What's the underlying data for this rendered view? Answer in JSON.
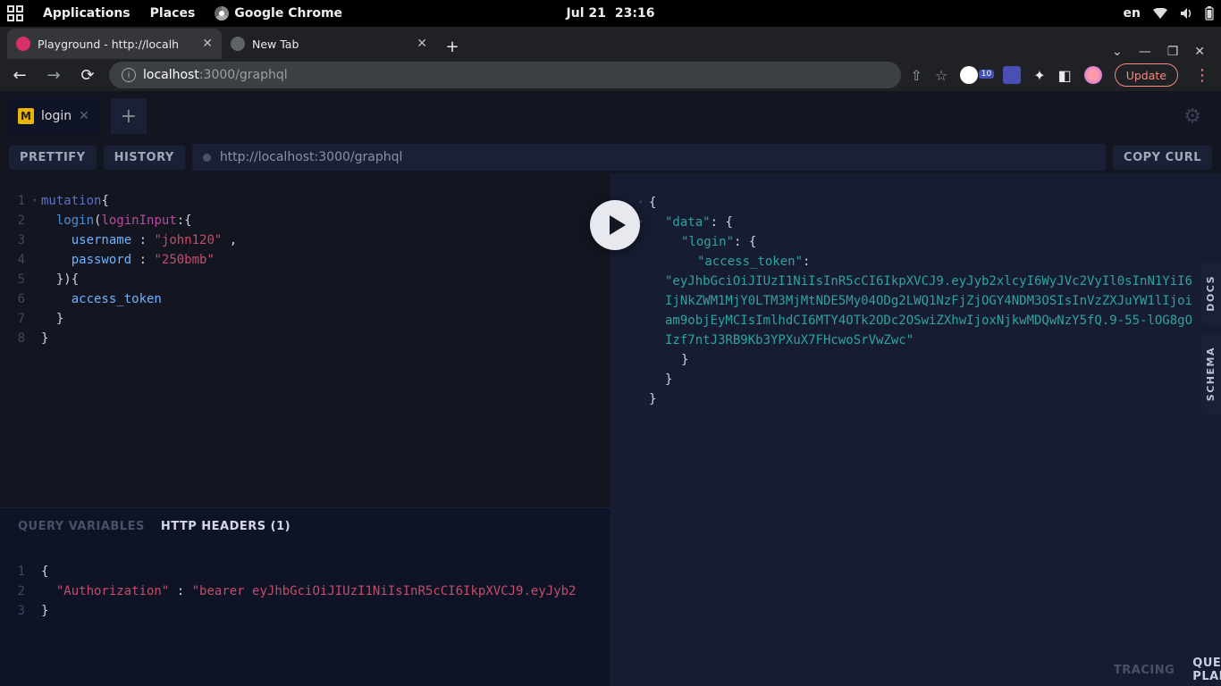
{
  "gnome": {
    "applications": "Applications",
    "places": "Places",
    "chrome": "Google Chrome",
    "date": "Jul 21",
    "time": "23:16",
    "lang": "en"
  },
  "chrome": {
    "tabs": [
      {
        "title": "Playground - http://localh"
      },
      {
        "title": "New Tab"
      }
    ],
    "url_host": "localhost",
    "url_rest": ":3000/graphql",
    "update": "Update",
    "ext_badge": "10"
  },
  "playground": {
    "tab": {
      "badge": "M",
      "name": "login"
    },
    "prettify": "PRETTIFY",
    "history": "HISTORY",
    "copy_curl": "COPY CURL",
    "endpoint": "http://localhost:3000/graphql",
    "side": {
      "docs": "DOCS",
      "schema": "SCHEMA"
    },
    "query": {
      "lines": [
        "1",
        "2",
        "3",
        "4",
        "5",
        "6",
        "7",
        "8"
      ],
      "kw_mutation": "mutation",
      "field_login": "login",
      "arg_loginInput": "loginInput",
      "attr_username": "username",
      "val_username": "\"john120\"",
      "attr_password": "password",
      "val_password": "\"250bmb\"",
      "attr_access_token": "access_token"
    },
    "response": {
      "data_key": "\"data\"",
      "login_key": "\"login\"",
      "access_token_key": "\"access_token\"",
      "token": "\"eyJhbGciOiJIUzI1NiIsInR5cCI6IkpXVCJ9.eyJyb2xlcyI6WyJVc2VyIl0sInN1YiI6IjNkZWM1MjY0LTM3MjMtNDE5My04ODg2LWQ1NzFjZjOGY4NDM3OSIsInVzZXJuYW1lIjoiam9objEyMCIsImlhdCI6MTY4OTk2ODc2OSwiZXhwIjoxNjkwMDQwNzY5fQ.9-55-lOG8gOIzf7ntJ3RB9Kb3YPXuX7FHcwoSrVwZwc\""
    },
    "vars": {
      "query_variables": "QUERY VARIABLES",
      "http_headers": "HTTP HEADERS (1)",
      "lines": [
        "1",
        "2",
        "3"
      ],
      "auth_key": "\"Authorization\"",
      "auth_val": "\"bearer eyJhbGciOiJIUzI1NiIsInR5cCI6IkpXVCJ9.eyJyb2"
    },
    "footer": {
      "tracing": "TRACING",
      "query_plan": "QUERY PLAN"
    }
  }
}
